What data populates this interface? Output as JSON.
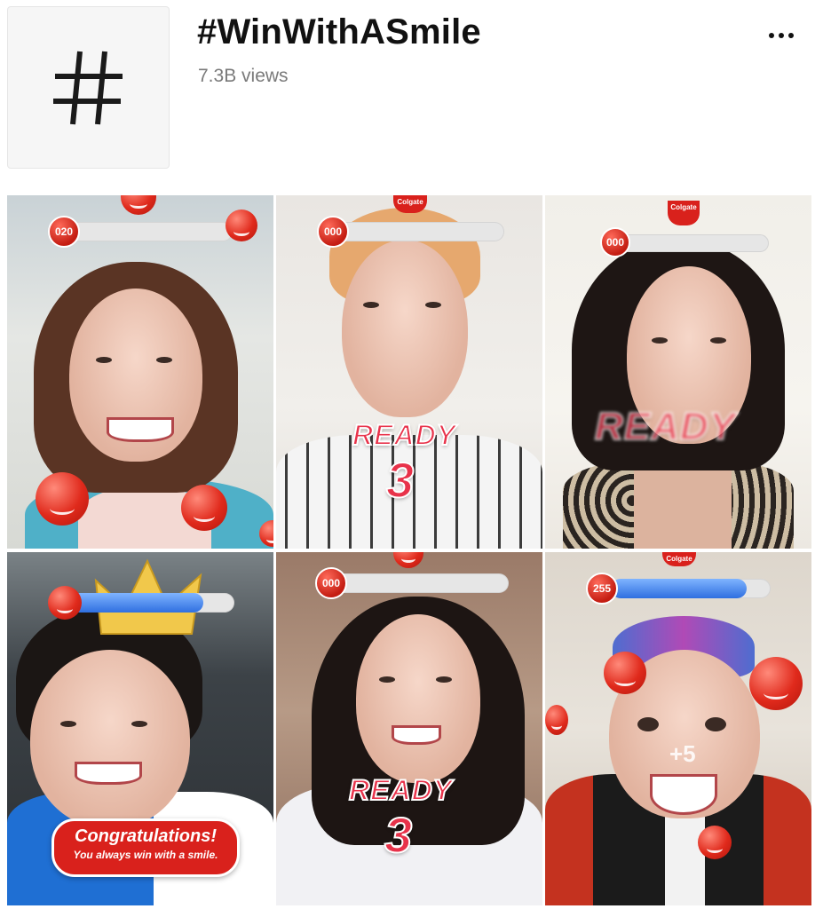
{
  "header": {
    "hashtag_glyph": "#",
    "title": "#WinWithASmile",
    "views": "7.3B views",
    "more_icon": "more-horizontal-icon"
  },
  "videos": [
    {
      "score": "020",
      "score_fill": 0.08
    },
    {
      "score": "000",
      "score_fill": 0.0,
      "ready": "READY",
      "countdown": "3",
      "logo": "Colgate"
    },
    {
      "score": "000",
      "score_fill": 0.0,
      "ready": "READY",
      "logo": "Colgate"
    },
    {
      "score_fill": 0.82,
      "banner_title": "Congratulations!",
      "banner_sub": "You always win with a smile."
    },
    {
      "score": "000",
      "score_fill": 0.0,
      "ready": "READY",
      "countdown": "3"
    },
    {
      "score": "255",
      "score_fill": 0.85,
      "bonus": "+5",
      "logo": "Colgate"
    }
  ],
  "colors": {
    "brand_red": "#d9211c",
    "ready_pink": "#e8324a",
    "bar_blue": "#2f6fe0"
  }
}
